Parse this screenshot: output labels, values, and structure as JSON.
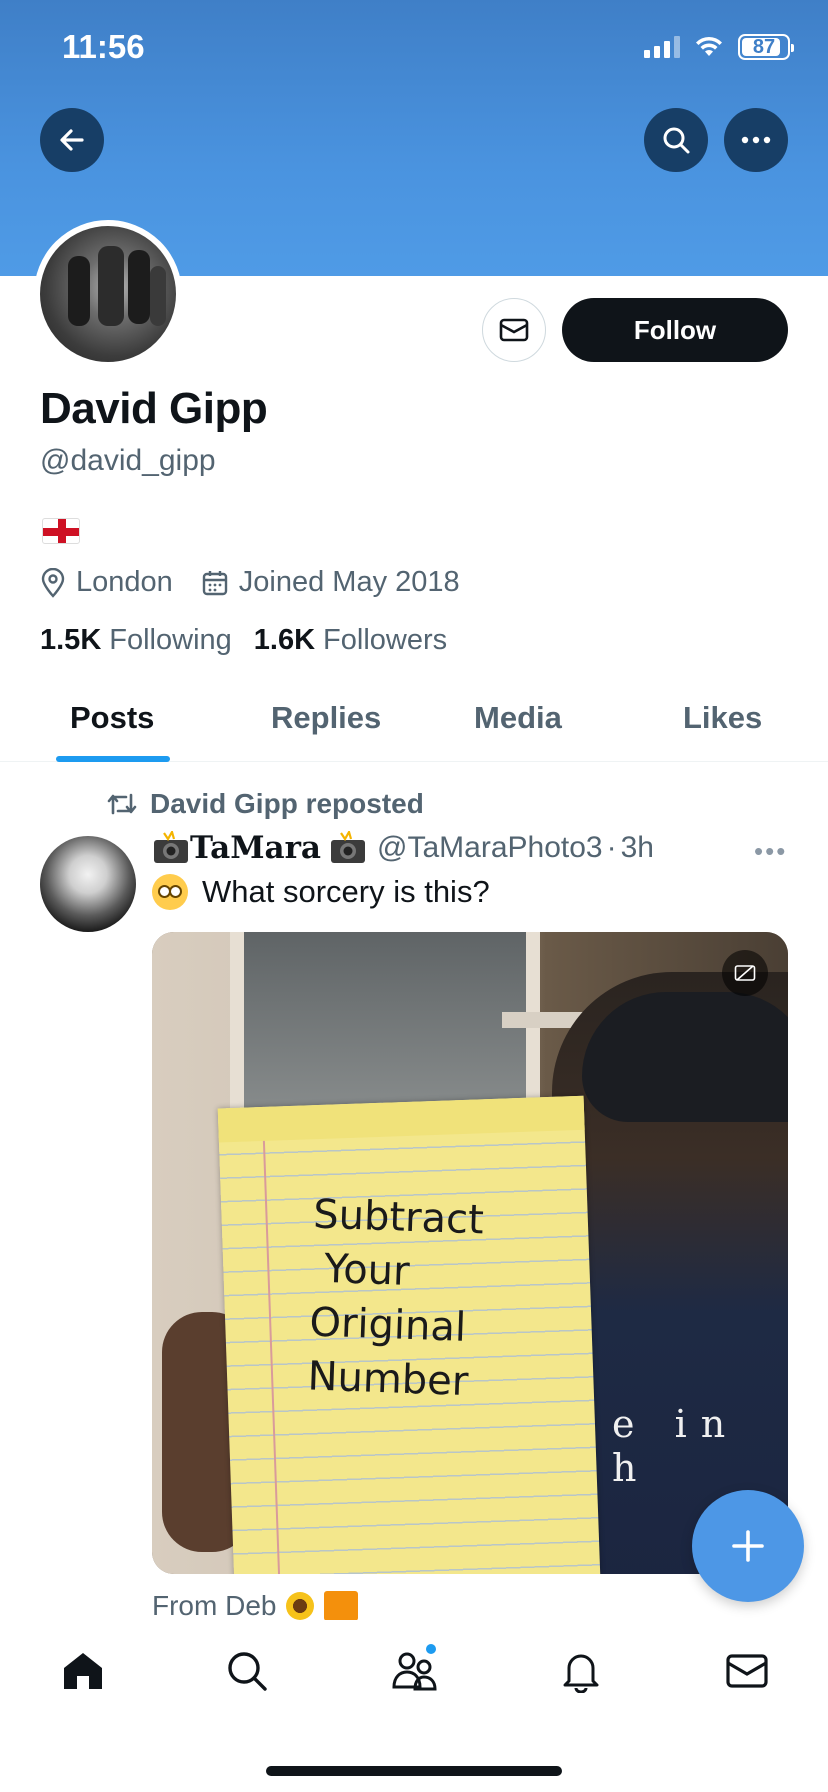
{
  "status_bar": {
    "time": "11:56",
    "battery": "87"
  },
  "header": {
    "back_icon": "arrow-left-icon",
    "search_icon": "search-icon",
    "more_icon": "more-horizontal-icon"
  },
  "profile": {
    "name": "David Gipp",
    "handle": "@david_gipp",
    "bio_flag": "England flag",
    "location": "London",
    "joined": "Joined May 2018",
    "following_count": "1.5K",
    "following_label": "Following",
    "followers_count": "1.6K",
    "followers_label": "Followers",
    "follow_label": "Follow"
  },
  "tabs": [
    {
      "label": "Posts",
      "active": true
    },
    {
      "label": "Replies",
      "active": false
    },
    {
      "label": "Media",
      "active": false
    },
    {
      "label": "Likes",
      "active": false
    }
  ],
  "post": {
    "repost_label": "David Gipp reposted",
    "author": "TaMara",
    "author_handle": "@TaMaraPhoto3",
    "separator": "·",
    "time": "3h",
    "text": "What sorcery is this?",
    "media_pad_text": "Subtract\n Your\nOriginal\nNumber",
    "media_shirt_text": "e in h",
    "footer_text": "From Deb"
  },
  "colors": {
    "accent": "#1d9bf0",
    "banner": "#4a93df",
    "primary_text": "#0f1419",
    "secondary_text": "#536471"
  }
}
